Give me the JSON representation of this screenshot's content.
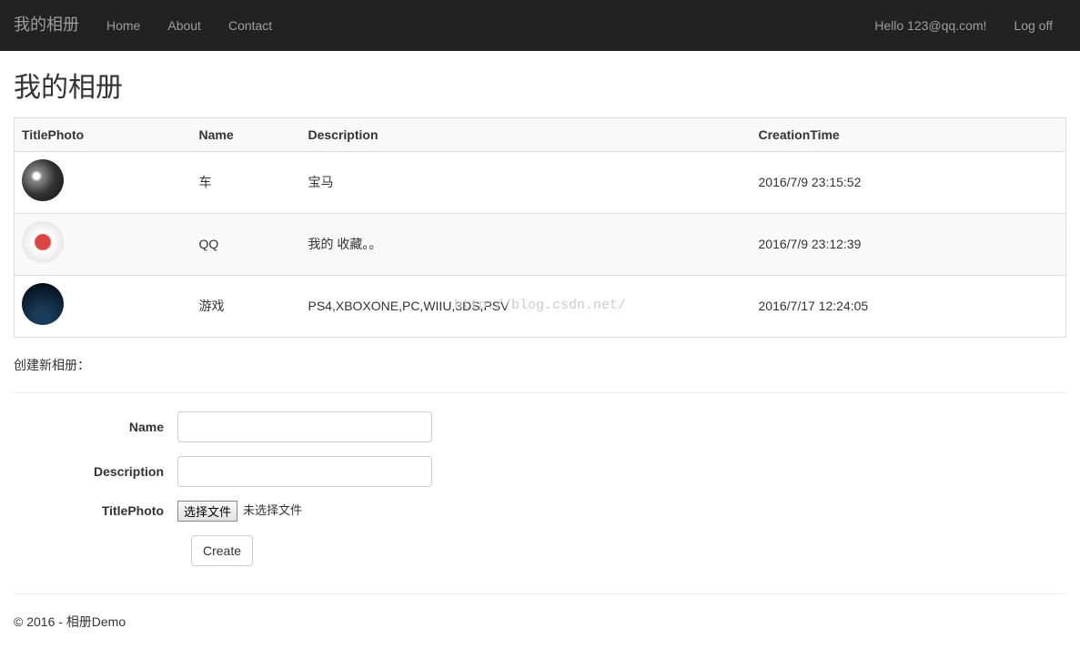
{
  "navbar": {
    "brand": "我的相册",
    "links": [
      {
        "label": "Home"
      },
      {
        "label": "About"
      },
      {
        "label": "Contact"
      }
    ],
    "greeting": "Hello 123@qq.com!",
    "logoff": "Log off"
  },
  "page": {
    "title": "我的相册",
    "createLabel": "创建新相册：",
    "watermark": "http://blog.csdn.net/"
  },
  "table": {
    "headers": {
      "titlePhoto": "TitlePhoto",
      "name": "Name",
      "description": "Description",
      "creationTime": "CreationTime"
    },
    "rows": [
      {
        "name": "车",
        "description": "宝马",
        "creationTime": "2016/7/9 23:15:52"
      },
      {
        "name": "QQ",
        "description": "我的 收藏。。",
        "creationTime": "2016/7/9 23:12:39"
      },
      {
        "name": "游戏",
        "description": "PS4,XBOXONE,PC,WIIU,3DS,PSV",
        "creationTime": "2016/7/17 12:24:05"
      }
    ]
  },
  "form": {
    "nameLabel": "Name",
    "descriptionLabel": "Description",
    "titlePhotoLabel": "TitlePhoto",
    "fileButton": "选择文件",
    "fileStatus": "未选择文件",
    "submit": "Create"
  },
  "footer": {
    "text": "© 2016 - 相册Demo"
  }
}
